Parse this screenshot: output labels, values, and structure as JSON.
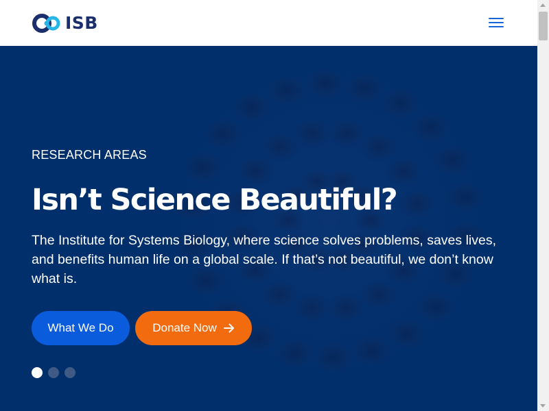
{
  "header": {
    "logo_text": "ISB",
    "logo_icon": "isb-infinity-logo",
    "menu_icon": "hamburger-menu-icon"
  },
  "hero": {
    "eyebrow": "RESEARCH AREAS",
    "title": "Isn’t Science Beautiful?",
    "description": "The Institute for Systems Biology, where science solves problems, saves lives, and benefits human life on a global scale. If that’s not beautiful, we don’t know what is.",
    "primary_button": "What We Do",
    "donate_button": "Donate Now",
    "donate_icon": "arrow-right-icon",
    "carousel": {
      "total_slides": 3,
      "active_slide": 1
    }
  },
  "colors": {
    "brand_navy": "#1a2f6b",
    "hero_background": "#002f6c",
    "primary_blue": "#0a5cdc",
    "donate_orange": "#f26b0f",
    "menu_blue": "#1565d8"
  }
}
